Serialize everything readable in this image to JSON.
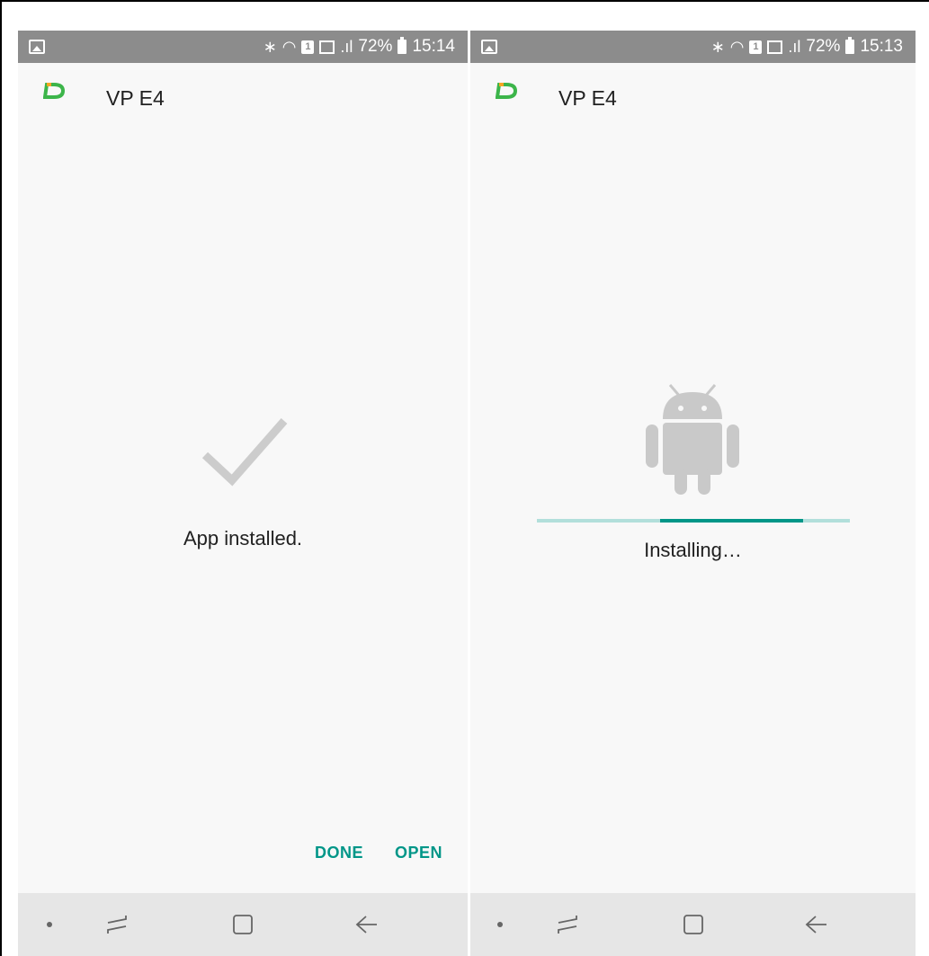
{
  "status_bar_left": {
    "time": "15:14",
    "battery": "72%"
  },
  "status_bar_right": {
    "time": "15:13",
    "battery": "72%"
  },
  "screens": [
    {
      "app_title": "VP E4",
      "message": "App installed.",
      "buttons": {
        "done": "DONE",
        "open": "OPEN"
      }
    },
    {
      "app_title": "VP E4",
      "message": "Installing…",
      "progress": {
        "indeterminate": true
      }
    }
  ],
  "colors": {
    "accent": "#009688",
    "accent_light": "#b2dfdb",
    "status_bar": "#8c8c8c",
    "background": "#f8f8f8",
    "nav_bar": "#e6e6e6",
    "logo_green": "#3cb54a",
    "logo_orange": "#f5a623",
    "icon_gray": "#c9c9c9"
  },
  "icons": {
    "status": [
      "image-icon",
      "bluetooth-icon",
      "wifi-icon",
      "sim-icon",
      "signal-icon",
      "battery-icon"
    ],
    "nav": [
      "dot-icon",
      "recent-apps-icon",
      "home-icon",
      "back-icon"
    ],
    "content": [
      "checkmark-icon",
      "android-icon"
    ]
  }
}
